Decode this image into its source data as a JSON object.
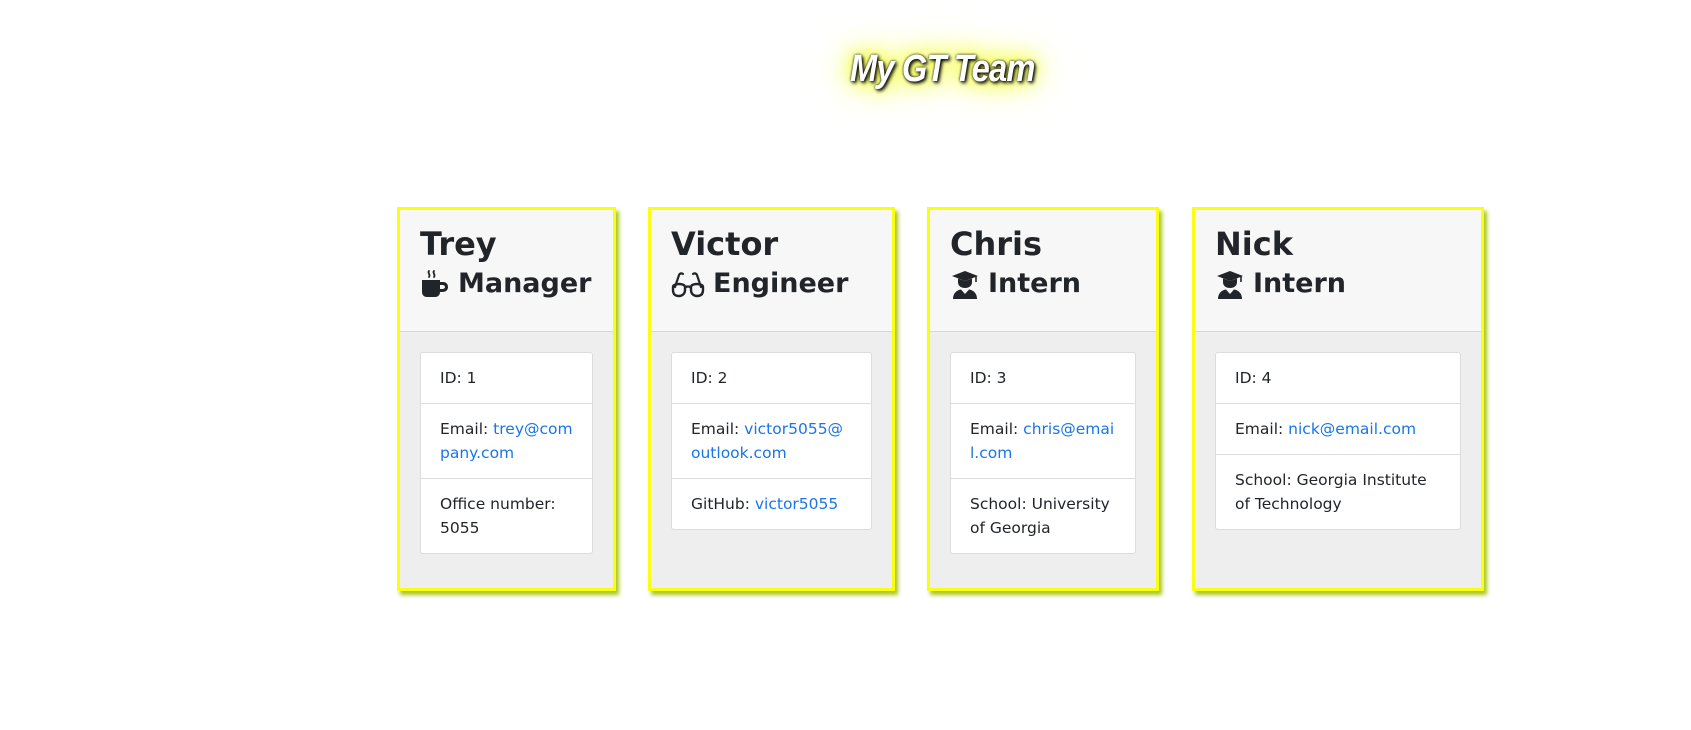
{
  "header": {
    "title": "My GT Team"
  },
  "cards": [
    {
      "name": "Trey",
      "role": "Manager",
      "icon": "coffee-mug-icon",
      "id_label": "ID: 1",
      "email_label": "Email:",
      "email": "trey@company.com",
      "extra_label": "Office number:",
      "extra_value": "5055"
    },
    {
      "name": "Victor",
      "role": "Engineer",
      "icon": "glasses-icon",
      "id_label": "ID: 2",
      "email_label": "Email:",
      "email": "victor5055@outlook.com",
      "extra_label": "GitHub:",
      "extra_value": "victor5055"
    },
    {
      "name": "Chris",
      "role": "Intern",
      "icon": "graduate-icon",
      "id_label": "ID: 3",
      "email_label": "Email:",
      "email": "chris@email.com",
      "extra_label": "School:",
      "extra_value": "University of Georgia"
    },
    {
      "name": "Nick",
      "role": "Intern",
      "icon": "graduate-icon",
      "id_label": "ID: 4",
      "email_label": "Email:",
      "email": "nick@email.com",
      "extra_label": "School:",
      "extra_value": "Georgia Institute of Technology"
    }
  ],
  "colors": {
    "card_border": "#faff12",
    "link": "#1976e8",
    "title_glow": "#f5ff00"
  }
}
